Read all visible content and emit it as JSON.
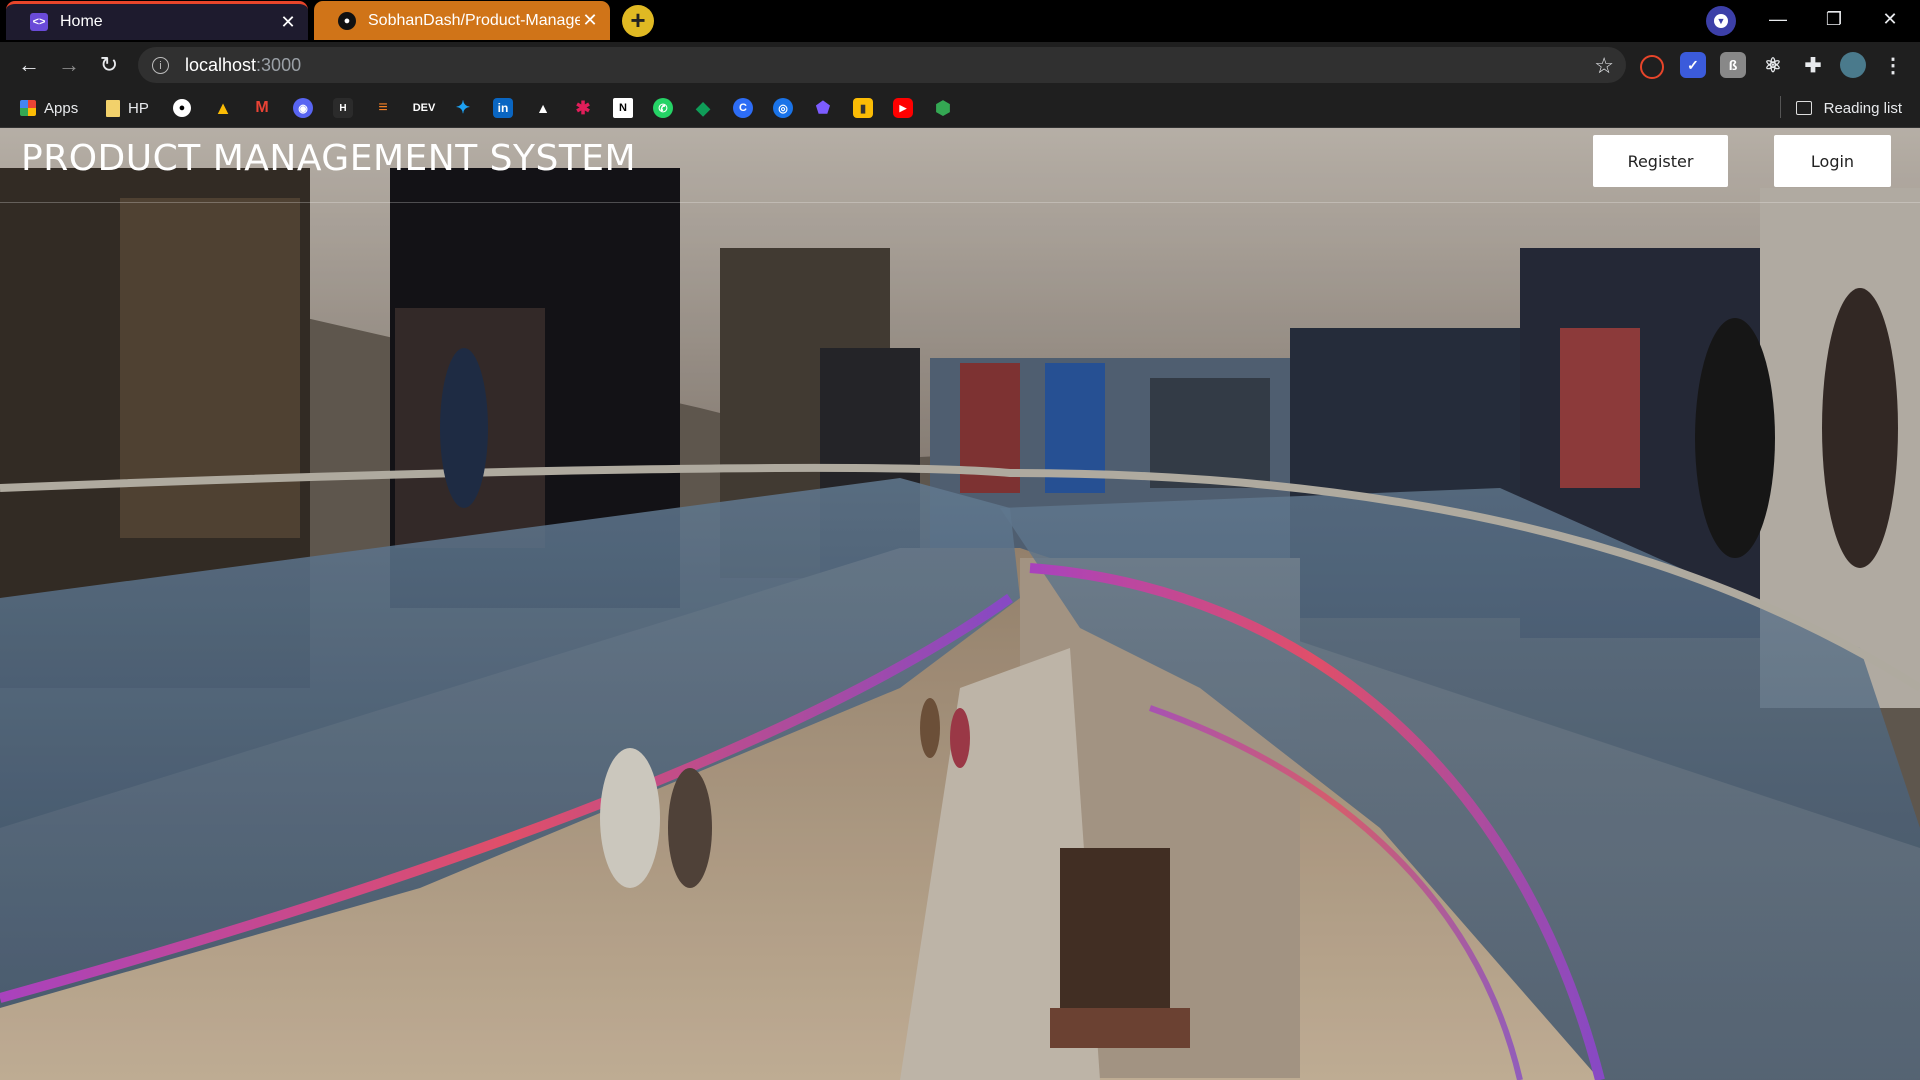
{
  "tabs": [
    {
      "title": "Home",
      "icon": "vscode-icon",
      "close": "✕"
    },
    {
      "title": "SobhanDash/Product-Manageme",
      "icon": "github-icon",
      "close": "✕"
    }
  ],
  "new_tab": "+",
  "window_controls": {
    "minimize": "—",
    "restore": "❐",
    "close": "✕"
  },
  "toolbar": {
    "back": "←",
    "forward": "→",
    "reload": "↻",
    "url_host": "localhost",
    "url_port": ":3000",
    "star": "☆"
  },
  "bookmarks": {
    "apps_label": "Apps",
    "hp_label": "HP",
    "reading_list": "Reading list",
    "icons": [
      "github",
      "google-drive",
      "gmail",
      "discord",
      "hashnode",
      "stackoverflow",
      "dev",
      "twitter",
      "linkedin",
      "vercel",
      "slack",
      "notion",
      "whatsapp",
      "sheets",
      "canva",
      "chrome",
      "obsidian",
      "keep",
      "youtube",
      "shield"
    ],
    "dev_label": "DEV",
    "linkedin_label": "in",
    "hashnode_label": "H"
  },
  "page": {
    "title": "PRODUCT MANAGEMENT SYSTEM",
    "register": "Register",
    "login": "Login",
    "background": "shopping-mall-photo"
  },
  "colors": {
    "tab_accent": "#e8452a",
    "other_tab": "#d07418",
    "new_tab": "#e0b923"
  }
}
